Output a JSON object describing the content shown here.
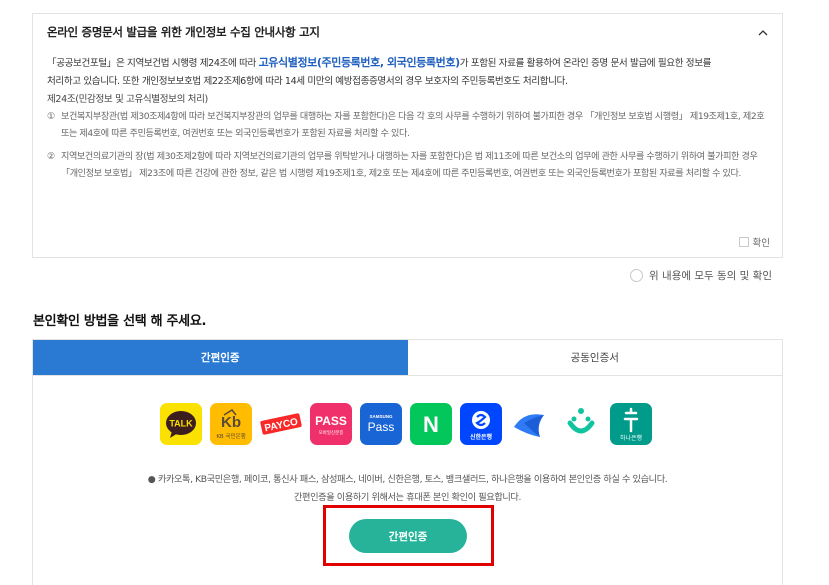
{
  "notice": {
    "title": "온라인 증명문서 발급을 위한 개인정보 수집 안내사항 고지",
    "p1_a": "「공공보건포털」은 지역보건법 시행령 제24조에 따라 ",
    "p1_hl": "고유식별정보(주민등록번호, 외국인등록번호)",
    "p1_b": "가 포함된 자료를 활용하여 온라인 증명 문서 발급에 필요한 정보를",
    "p1_c": "처리하고 있습니다. 또한 개인정보보호법 제22조제6항에 따라 14세 미만의 예방접종증명서의 경우 보호자의 주민등록번호도 처리합니다.",
    "article": "제24조(민감정보 및 고유식별정보의 처리)",
    "item1_num": "①",
    "item1": "보건복지부장관(법 제30조제4항에 따라 보건복지부장관의 업무를 대행하는 자를 포함한다)은 다음 각 호의 사무를 수행하기 위하여 불가피한 경우 「개인정보 보호법 시행령」 제19조제1호, 제2호 또는 제4호에 따른 주민등록번호, 여권번호 또는 외국인등록번호가 포함된 자료를 처리할 수 있다.",
    "item2_num": "②",
    "item2": "지역보건의료기관의 장(법 제30조제2항에 따라 지역보건의료기관의 업무를 위탁받거나 대행하는 자를 포함한다)은 법 제11조에 따른 보건소의 업무에 관한 사무를 수행하기 위하여 불가피한 경우 「개인정보 보호법」 제23조에 따른 건강에 관한 정보, 같은 법 시행령 제19조제1호, 제2호 또는 제4호에 따른 주민등록번호, 여권번호 또는 외국인등록번호가 포함된 자료를 처리할 수 있다.",
    "confirm_label": "확인"
  },
  "agree_all_label": "위 내용에 모두 동의 및 확인",
  "section_title": "본인확인 방법을 선택 해 주세요.",
  "tabs": [
    {
      "label": "간편인증",
      "active": true
    },
    {
      "label": "공동인증서",
      "active": false
    }
  ],
  "providers": [
    {
      "name": "kakaotalk-icon",
      "text": "TALK"
    },
    {
      "name": "kb-bank-icon",
      "text": "KB 국민은행"
    },
    {
      "name": "payco-icon",
      "text": "PAYCO"
    },
    {
      "name": "pass-icon",
      "text": "PASS",
      "sub": "모바일신분증"
    },
    {
      "name": "samsung-pass-icon",
      "text": "Pass",
      "sub": "SAMSUNG"
    },
    {
      "name": "naver-icon",
      "text": "N"
    },
    {
      "name": "shinhan-bank-icon",
      "text": "신한은행"
    },
    {
      "name": "toss-icon",
      "text": ""
    },
    {
      "name": "banksalad-icon",
      "text": ""
    },
    {
      "name": "hana-bank-icon",
      "text": "하나은행"
    }
  ],
  "info_line1": "카카오톡, KB국민은행, 페이코, 통신사 패스, 삼성패스, 네이버, 신한은행, 토스, 뱅크샐러드, 하나은행을 이용하여 본인인증 하실 수 있습니다.",
  "info_line2": "간편인증을 이용하기 위해서는 휴대폰 본인 확인이 필요합니다.",
  "cta_label": "간편인증",
  "colors": {
    "tab_active": "#2a7ad4",
    "cta": "#26b39a",
    "highlight_box": "#e00000",
    "link_blue": "#1f5fbf"
  }
}
